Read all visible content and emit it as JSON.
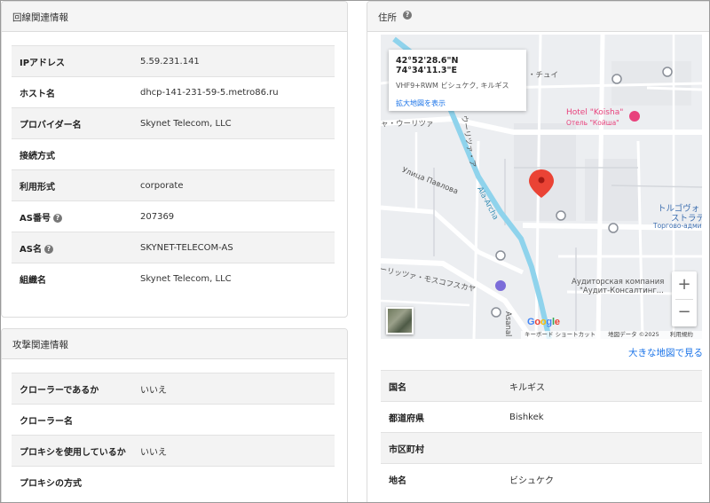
{
  "line_info": {
    "title": "回線関連情報",
    "rows": [
      {
        "key": "IPアドレス",
        "value": "5.59.231.141",
        "help": false
      },
      {
        "key": "ホスト名",
        "value": "dhcp-141-231-59-5.metro86.ru",
        "help": false
      },
      {
        "key": "プロバイダー名",
        "value": "Skynet Telecom, LLC",
        "help": false
      },
      {
        "key": "接続方式",
        "value": "",
        "help": false
      },
      {
        "key": "利用形式",
        "value": "corporate",
        "help": false
      },
      {
        "key": "AS番号",
        "value": "207369",
        "help": true
      },
      {
        "key": "AS名",
        "value": "SKYNET-TELECOM-AS",
        "help": true
      },
      {
        "key": "組織名",
        "value": "Skynet Telecom, LLC",
        "help": false
      }
    ]
  },
  "attack_info": {
    "title": "攻撃関連情報",
    "rows": [
      {
        "key": "クローラーであるか",
        "value": "いいえ"
      },
      {
        "key": "クローラー名",
        "value": ""
      },
      {
        "key": "プロキシを使用しているか",
        "value": "いいえ"
      },
      {
        "key": "プロキシの方式",
        "value": ""
      }
    ]
  },
  "address": {
    "title": "住所",
    "map": {
      "coordinates": "42°52'28.6\"N 74°34'11.3\"E",
      "plus_code": "VHF9+RWM ビシュケク, キルギス",
      "enlarge_link": "拡大地図を表示",
      "labels": {
        "chui": "・チュイ",
        "uulitsa_top": "ャ・ウーリツァ",
        "hotel": "Hotel \"Koisha\"",
        "hotel_ru": "Отель \"Койша\"",
        "pavlova": "Улица Павлова",
        "uulitsa_vert": "ウーリツァ・ア",
        "alaarcha": "Ala-Archa",
        "trg1": "トルゴヴォ",
        "trg2": "ストラテ",
        "trg3": "Торгово-админи",
        "audit1": "Аудиторская компания",
        "audit2": "\"Аудит-Консалтинг...",
        "moskov": "ーリッツァ・モスコフスカヤ",
        "asanal": "Asanal"
      },
      "zoom_in": "+",
      "zoom_out": "−",
      "google": "Google",
      "attribution": {
        "shortcuts": "キーボード ショートカット",
        "mapdata": "地図データ ©2025",
        "terms": "利用規約"
      }
    },
    "big_map_link": "大きな地図で見る",
    "rows": [
      {
        "key": "国名",
        "value": "キルギス"
      },
      {
        "key": "都道府県",
        "value": "Bishkek"
      },
      {
        "key": "市区町村",
        "value": ""
      },
      {
        "key": "地名",
        "value": "ビシュケク"
      }
    ]
  },
  "colors": {
    "link": "#1a73e8",
    "pin": "#ea4335",
    "river": "#8fd3ec",
    "hotel_pink": "#e8427c"
  }
}
